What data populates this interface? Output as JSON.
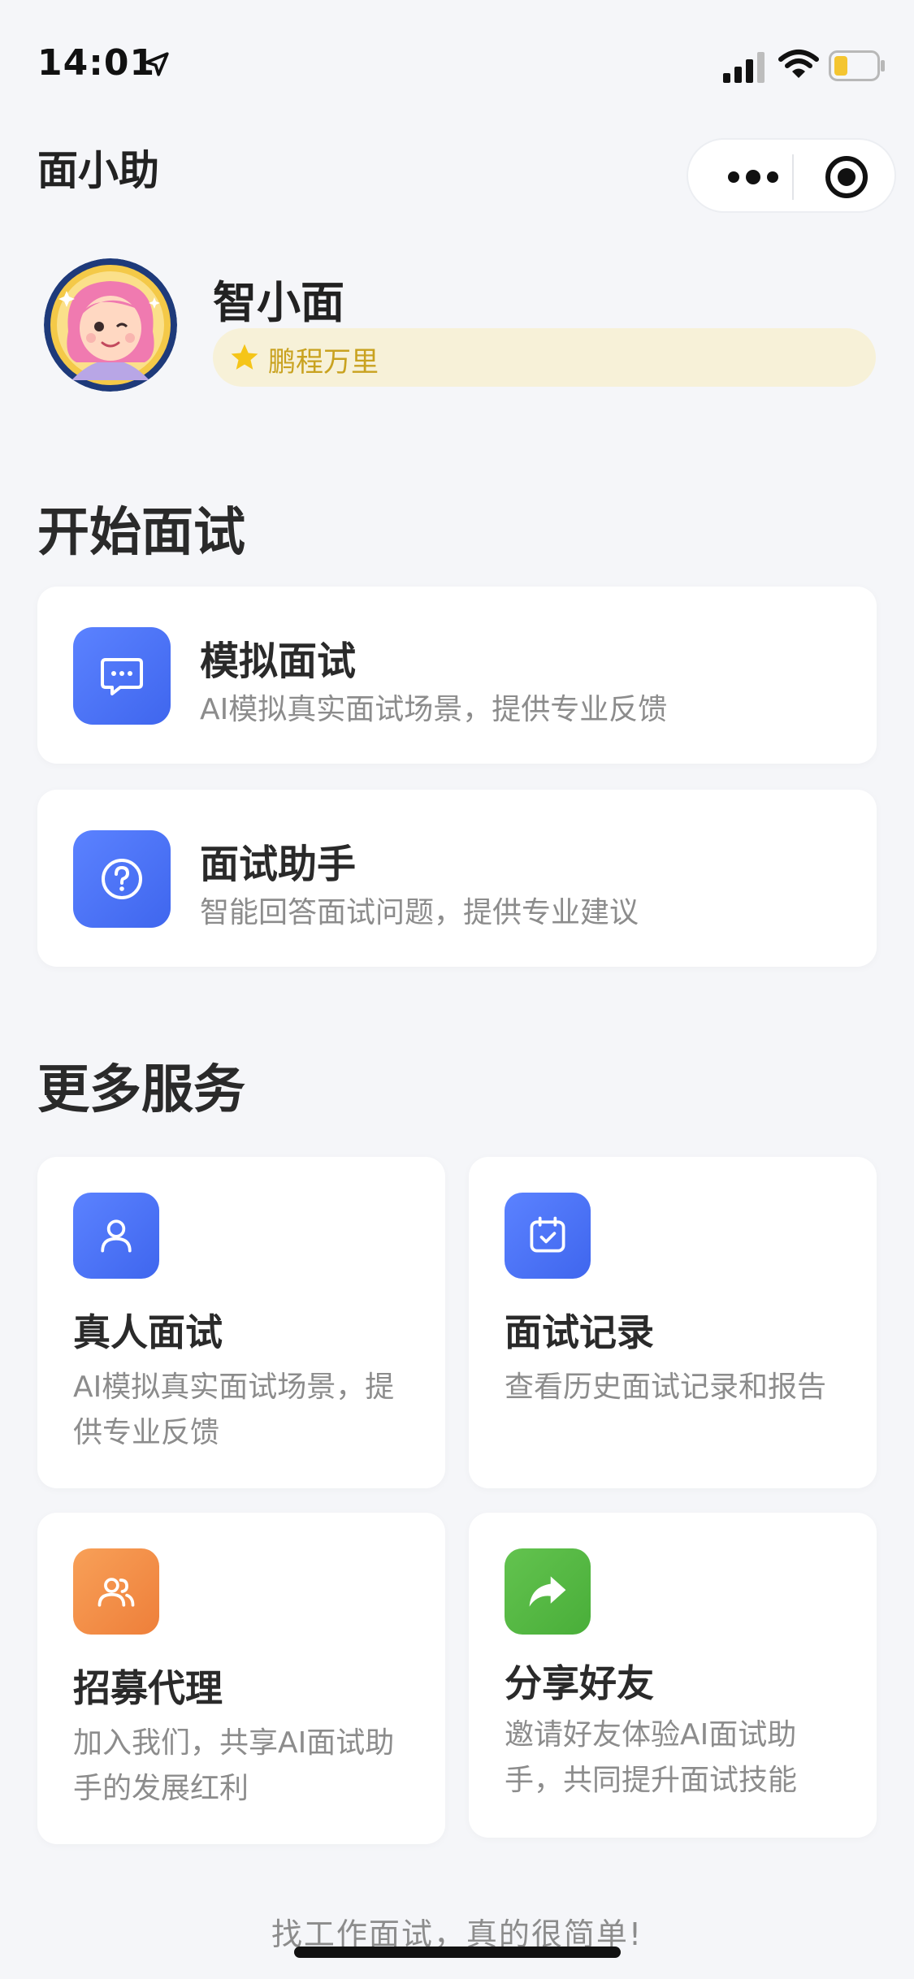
{
  "status_bar": {
    "time": "14:01"
  },
  "nav": {
    "title": "面小助"
  },
  "profile": {
    "name": "智小面",
    "level": "鹏程万里"
  },
  "start_section": {
    "title": "开始面试",
    "cards": [
      {
        "title": "模拟面试",
        "desc": "AI模拟真实面试场景，提供专业反馈",
        "icon": "chat-bubble-icon"
      },
      {
        "title": "面试助手",
        "desc": "智能回答面试问题，提供专业建议",
        "icon": "question-circle-icon"
      }
    ]
  },
  "more_section": {
    "title": "更多服务",
    "cards": [
      {
        "title": "真人面试",
        "desc": "AI模拟真实面试场景，提供专业反馈",
        "icon": "person-icon",
        "color": "#4f74f6"
      },
      {
        "title": "面试记录",
        "desc": "查看历史面试记录和报告",
        "icon": "calendar-check-icon",
        "color": "#4f74f6"
      },
      {
        "title": "招募代理",
        "desc": "加入我们，共享AI面试助手的发展红利",
        "icon": "people-icon",
        "color": "#f08a45"
      },
      {
        "title": "分享好友",
        "desc": "邀请好友体验AI面试助手，共同提升面试技能",
        "icon": "share-arrow-icon",
        "color": "#55b944"
      }
    ]
  },
  "footer": {
    "slogan": "找工作面试，真的很简单!"
  },
  "colors": {
    "accent_blue": "#4f74f6",
    "badge_bg": "#f7f1d8",
    "badge_text": "#c9a21f"
  }
}
